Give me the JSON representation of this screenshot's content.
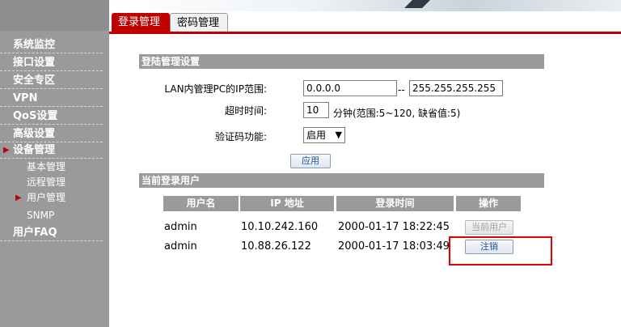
{
  "sidebar": {
    "items": [
      {
        "label": "系统监控"
      },
      {
        "label": "接口设置"
      },
      {
        "label": "安全专区"
      },
      {
        "label": "VPN"
      },
      {
        "label": "QoS设置"
      },
      {
        "label": "高级设置"
      },
      {
        "label": "设备管理"
      }
    ],
    "subitems": [
      {
        "label": "基本管理"
      },
      {
        "label": "远程管理"
      },
      {
        "label": "用户管理"
      },
      {
        "label": "SNMP"
      }
    ],
    "faq": "用户FAQ"
  },
  "tabs": [
    {
      "label": "登录管理"
    },
    {
      "label": "密码管理"
    }
  ],
  "login_settings": {
    "title": "登陆管理设置",
    "ip_range_label": "LAN内管理PC的IP范围:",
    "ip_start": "0.0.0.0",
    "ip_sep": "--",
    "ip_end": "255.255.255.255",
    "timeout_label": "超时时间:",
    "timeout_value": "10",
    "timeout_note": "分钟(范围:5~120, 缺省值:5)",
    "captcha_label": "验证码功能:",
    "captcha_value": "启用",
    "apply_label": "应用"
  },
  "current_users": {
    "title": "当前登录用户",
    "columns": [
      "用户名",
      "IP 地址",
      "登录时间",
      "操作"
    ],
    "rows": [
      {
        "user": "admin",
        "ip": "10.10.242.160",
        "time": "2000-01-17 18:22:45",
        "action": "当前用户"
      },
      {
        "user": "admin",
        "ip": "10.88.26.122",
        "time": "2000-01-17 18:03:49",
        "action": "注销"
      }
    ]
  },
  "colors": {
    "accent": "#c00000",
    "sidebar": "#9a9a9a",
    "highlight": "#e00000"
  }
}
